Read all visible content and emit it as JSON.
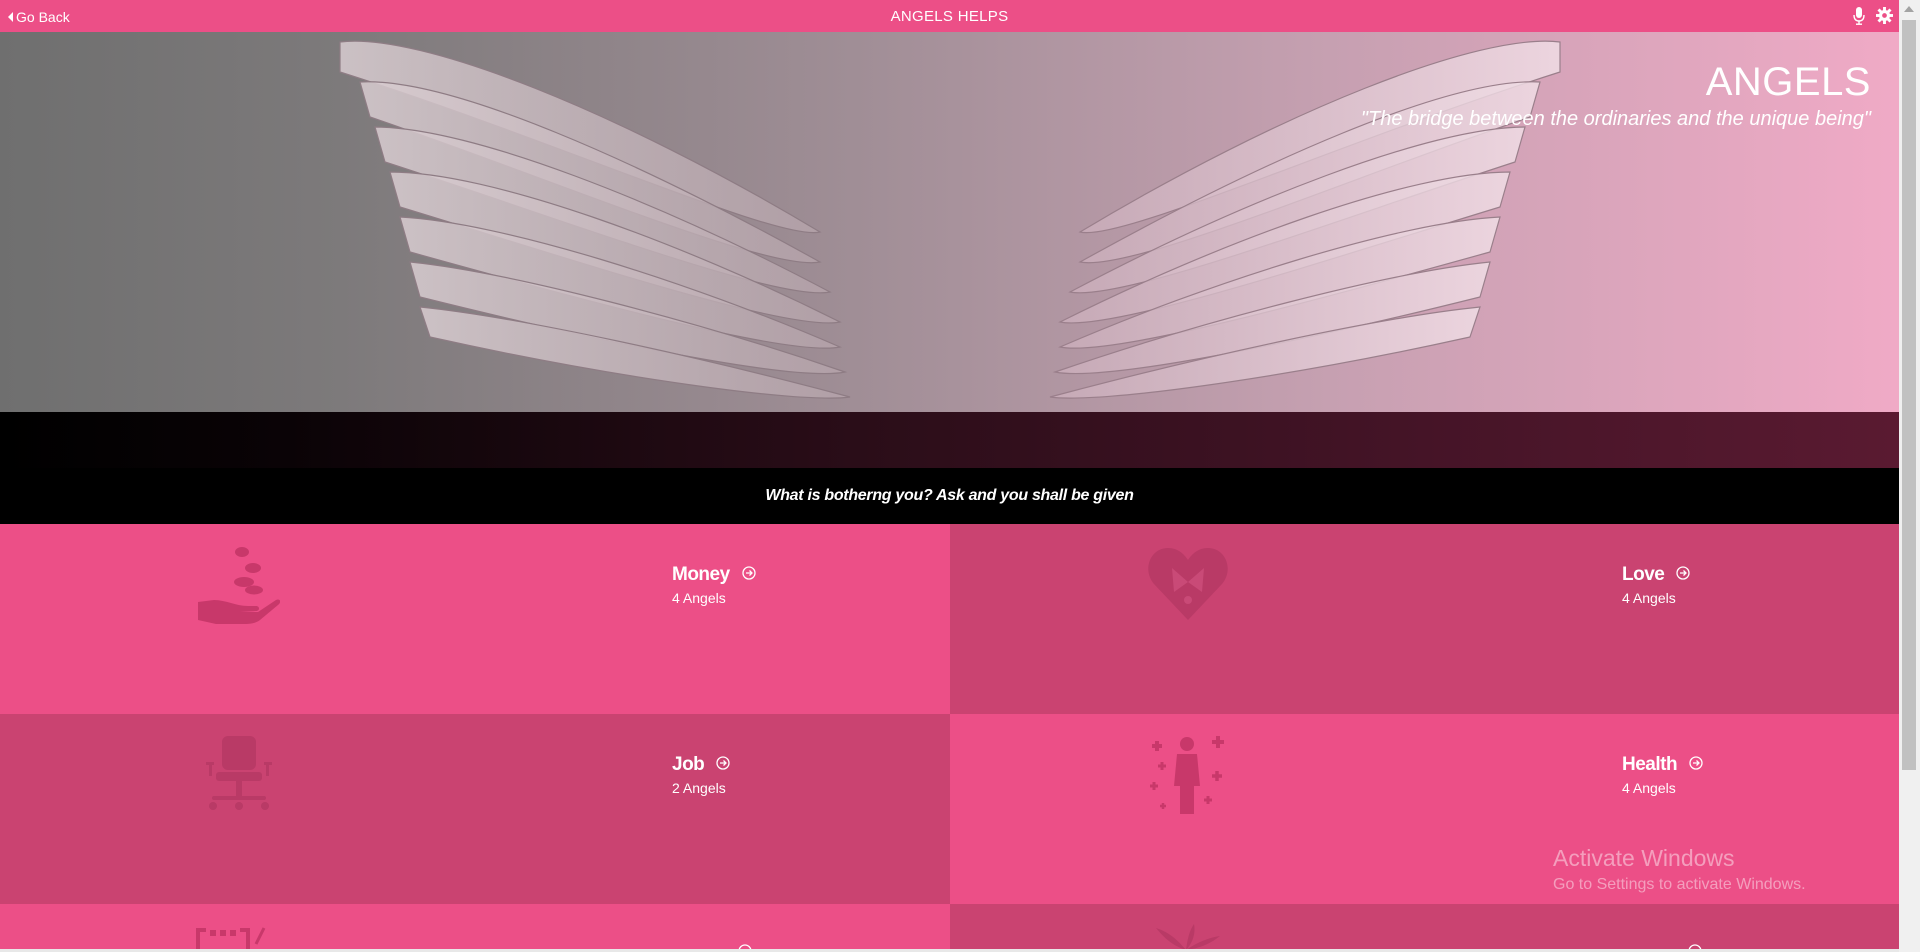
{
  "topbar": {
    "back_label": "Go Back",
    "title": "ANGELS HELPS",
    "icons": [
      "mic-icon",
      "gear-icon"
    ]
  },
  "hero": {
    "title": "ANGELS",
    "quote": "\"The bridge between the ordinaries and the unique being\""
  },
  "prompt": "What is botherng you? Ask and you shall be given",
  "categories": [
    {
      "name": "Money",
      "count": "4 Angels",
      "icon": "money-hand-icon"
    },
    {
      "name": "Love",
      "count": "4 Angels",
      "icon": "heart-icon"
    },
    {
      "name": "Job",
      "count": "2 Angels",
      "icon": "office-chair-icon"
    },
    {
      "name": "Health",
      "count": "4 Angels",
      "icon": "health-person-icon"
    }
  ],
  "watermark": {
    "line1": "Activate Windows",
    "line2": "Go to Settings to activate Windows."
  },
  "colors": {
    "accent": "#ec4f87",
    "accent_dark": "#ca4371",
    "prompt_bg": "#000000"
  }
}
